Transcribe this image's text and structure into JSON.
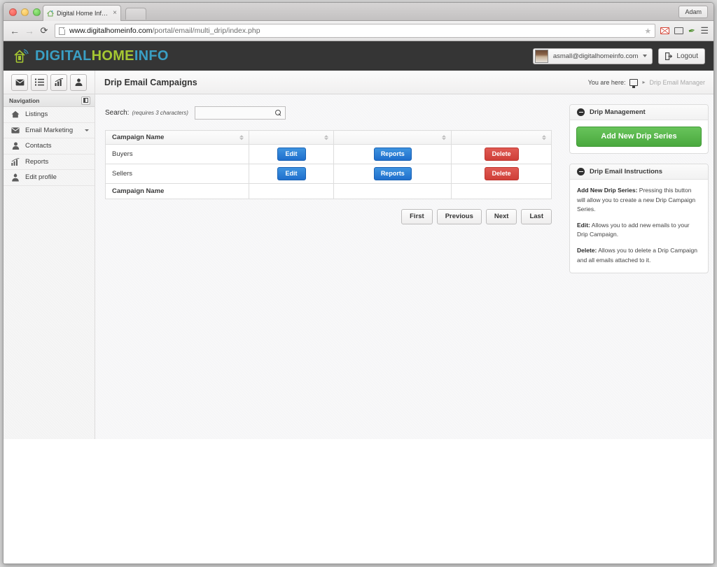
{
  "browser": {
    "tab": {
      "title": "Digital Home Info Email",
      "close_label": "×",
      "favicon": "house-favicon"
    },
    "new_tab_label": "",
    "profile_label": "Adam",
    "nav": {
      "back": "←",
      "forward": "→",
      "reload": "⟳"
    },
    "url": {
      "domain": "www.digitalhomeinfo.com",
      "path": "/portal/email/multi_drip/index.php"
    },
    "icons": {
      "star": "★",
      "gmail": "gmail-icon",
      "cast": "cast-icon",
      "pen": "✒",
      "menu": "☰"
    }
  },
  "app": {
    "brand": {
      "part1": "DIGITAL",
      "part2": "HOME",
      "part3": "INFO",
      "color1": "#3a9fc4",
      "color2": "#a5c732"
    },
    "account": {
      "email": "asmall@digitalhomeinfo.com"
    },
    "logout_label": "Logout"
  },
  "toolbar": {
    "buttons": [
      {
        "name": "email-icon",
        "glyph": "✉"
      },
      {
        "name": "list-icon",
        "glyph": "☰"
      },
      {
        "name": "chart-icon",
        "glyph": "ᐃ"
      },
      {
        "name": "profile-upload-icon",
        "glyph": "⚑"
      }
    ]
  },
  "header": {
    "page_title": "Drip Email Campaigns",
    "breadcrumb": {
      "label": "You are here:",
      "home_icon": "monitor-icon",
      "separator": "▸",
      "current": "Drip Email Manager"
    }
  },
  "sidebar": {
    "header": "Navigation",
    "collapse_icon": "collapse-panel-icon",
    "items": [
      {
        "label": "Listings",
        "icon": "home-icon",
        "glyph": "⌂",
        "caret": false
      },
      {
        "label": "Email Marketing",
        "icon": "envelope-icon",
        "glyph": "✉",
        "caret": true
      },
      {
        "label": "Contacts",
        "icon": "person-icon",
        "glyph": "♟",
        "caret": false
      },
      {
        "label": "Reports",
        "icon": "chart-icon",
        "glyph": "ᐃ",
        "caret": false
      },
      {
        "label": "Edit profile",
        "icon": "profile-upload-icon",
        "glyph": "⚑",
        "caret": false
      }
    ]
  },
  "search": {
    "label": "Search:",
    "hint": "(requires 3 characters)",
    "value": "",
    "placeholder": "",
    "icon": "search-icon"
  },
  "table": {
    "columns": [
      "Campaign Name",
      "",
      "",
      ""
    ],
    "footer_columns": [
      "Campaign Name",
      "",
      "",
      ""
    ],
    "rows": [
      {
        "name": "Buyers",
        "edit": "Edit",
        "reports": "Reports",
        "delete": "Delete"
      },
      {
        "name": "Sellers",
        "edit": "Edit",
        "reports": "Reports",
        "delete": "Delete"
      }
    ]
  },
  "pagination": {
    "first": "First",
    "previous": "Previous",
    "next": "Next",
    "last": "Last"
  },
  "panels": {
    "management": {
      "title": "Drip Management",
      "button_label": "Add New Drip Series",
      "button_color": "#4aa93e"
    },
    "instructions": {
      "title": "Drip Email Instructions",
      "items": [
        {
          "term": "Add New Drip Series:",
          "text": " Pressing this button will allow you to create a new Drip Campaign Series."
        },
        {
          "term": "Edit:",
          "text": " Allows you to add new emails to your Drip Campaign."
        },
        {
          "term": "Delete:",
          "text": " Allows you to delete a Drip Campaign and all emails attached to it."
        }
      ]
    }
  }
}
